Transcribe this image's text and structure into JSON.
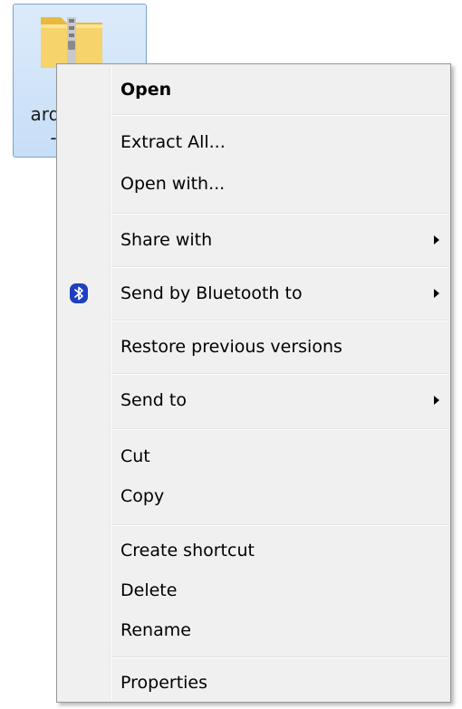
{
  "file": {
    "name_line1": "ardu",
    "name_line2": "-w",
    "icon": "zip-folder-icon"
  },
  "menu": {
    "items": [
      {
        "label": "Open",
        "bold": true,
        "submenu": false
      },
      {
        "label": "Extract All...",
        "bold": false,
        "submenu": false
      },
      {
        "label": "Open with...",
        "bold": false,
        "submenu": false
      },
      {
        "label": "Share with",
        "bold": false,
        "submenu": true
      },
      {
        "label": "Send by Bluetooth to",
        "bold": false,
        "submenu": true,
        "icon": "bluetooth-icon"
      },
      {
        "label": "Restore previous versions",
        "bold": false,
        "submenu": false
      },
      {
        "label": "Send to",
        "bold": false,
        "submenu": true
      },
      {
        "label": "Cut",
        "bold": false,
        "submenu": false
      },
      {
        "label": "Copy",
        "bold": false,
        "submenu": false
      },
      {
        "label": "Create shortcut",
        "bold": false,
        "submenu": false
      },
      {
        "label": "Delete",
        "bold": false,
        "submenu": false
      },
      {
        "label": "Rename",
        "bold": false,
        "submenu": false
      },
      {
        "label": "Properties",
        "bold": false,
        "submenu": false
      }
    ]
  },
  "colors": {
    "menu_background": "#f0f0f0",
    "selection_highlight": "#c7def7",
    "bluetooth": "#1e3fbf"
  }
}
